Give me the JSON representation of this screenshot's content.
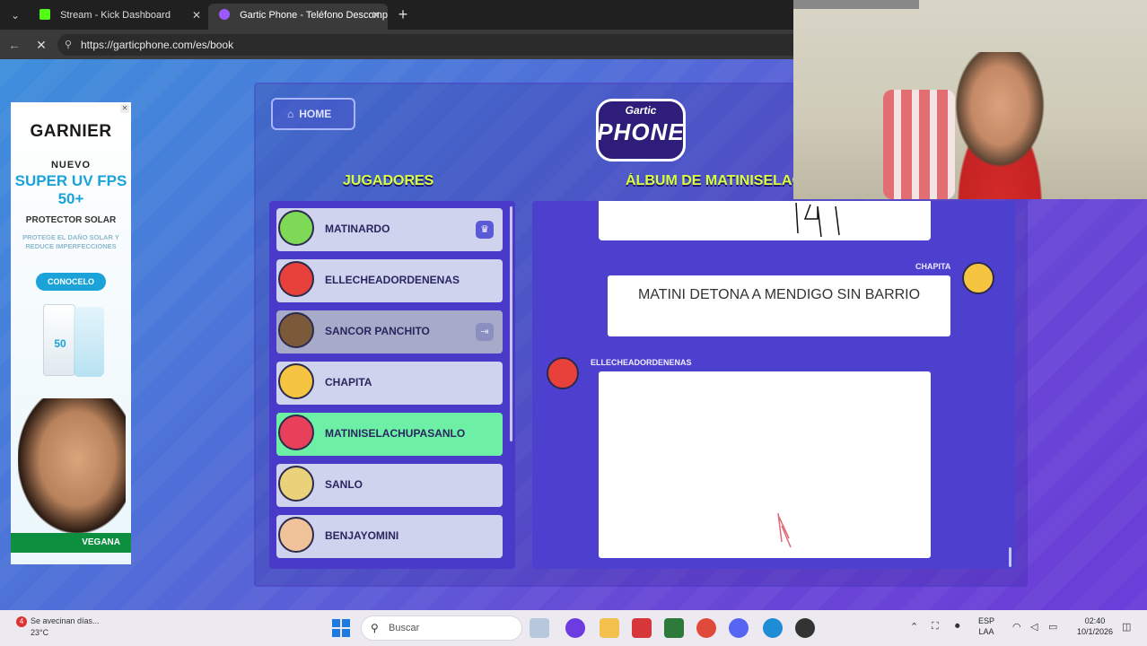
{
  "browser": {
    "tabs": [
      {
        "title": "Stream - Kick Dashboard",
        "icon": "kick-icon",
        "color": "#53fc18"
      },
      {
        "title": "Gartic Phone - Teléfono Descompuesto",
        "icon": "gartic-icon",
        "color": "#9b59ff"
      }
    ],
    "url": "https://garticphone.com/es/book"
  },
  "ad": {
    "brand": "GARNIER",
    "tag": "NUEVO",
    "headline": "SUPER UV FPS 50+",
    "subhead": "PROTECTOR SOLAR",
    "small": "PROTEGE EL DAÑO SOLAR Y REDUCE IMPERFECCIONES",
    "cta": "CONOCELO",
    "bottle_label": "50",
    "footer": "VEGANA"
  },
  "game": {
    "home_label": "HOME",
    "logo_top": "Gartic",
    "logo_main": "PHONE",
    "players_title": "JUGADORES",
    "album_title": "ÁLBUM DE MATINISELACHUPASANLO",
    "players": [
      {
        "name": "MATINARDO",
        "avatar_color": "#7ed957",
        "badge": "crown-icon",
        "state": "normal"
      },
      {
        "name": "ELLECHEADORDENENAS",
        "avatar_color": "#e8403a",
        "badge": "",
        "state": "normal"
      },
      {
        "name": "SANCOR PANCHITO",
        "avatar_color": "#7b5a3a",
        "badge": "exit-icon",
        "state": "dim"
      },
      {
        "name": "CHAPITA",
        "avatar_color": "#f5c542",
        "badge": "",
        "state": "normal"
      },
      {
        "name": "MATINISELACHUPASANLO",
        "avatar_color": "#e8405a",
        "badge": "",
        "state": "me"
      },
      {
        "name": "SANLO",
        "avatar_color": "#e9d27a",
        "badge": "",
        "state": "normal"
      },
      {
        "name": "BENJAYOMINI",
        "avatar_color": "#f0c29a",
        "badge": "",
        "state": "normal"
      }
    ],
    "album": {
      "entries": [
        {
          "author": "CHAPITA",
          "text": "MATINI DETONA A MENDIGO SIN BARRIO",
          "avatar_color": "#f5c542"
        },
        {
          "author": "ELLECHEADORDENENAS",
          "avatar_color": "#e8403a"
        }
      ]
    }
  },
  "taskbar": {
    "weather_text": "Se avecinan días...",
    "weather_temp": "23°C",
    "weather_badge": "4",
    "search_placeholder": "Buscar",
    "lang_top": "ESP",
    "lang_bottom": "LAA",
    "time": "02:40",
    "date": "10/1/2026"
  }
}
